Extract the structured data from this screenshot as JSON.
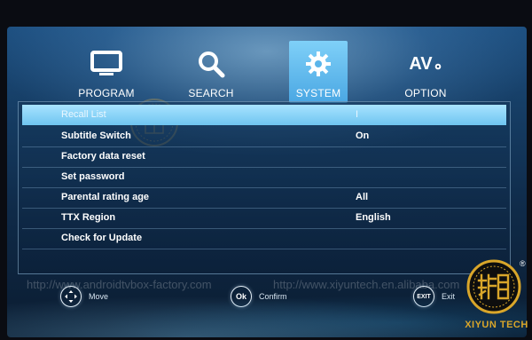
{
  "tabs": [
    {
      "label": "PROGRAM",
      "icon": "monitor-icon",
      "active": false
    },
    {
      "label": "SEARCH",
      "icon": "search-icon",
      "active": false
    },
    {
      "label": "SYSTEM",
      "icon": "gear-icon",
      "active": true
    },
    {
      "label": "OPTION",
      "icon": "av-settings-icon",
      "active": false,
      "icon_text": "AV"
    }
  ],
  "menu": {
    "rows": [
      {
        "label": "Recall List",
        "value": "I",
        "selected": true
      },
      {
        "label": "Subtitle Switch",
        "value": "On",
        "selected": false
      },
      {
        "label": "Factory data reset",
        "value": "",
        "selected": false
      },
      {
        "label": "Set password",
        "value": "",
        "selected": false
      },
      {
        "label": "Parental rating age",
        "value": "All",
        "selected": false
      },
      {
        "label": "TTX Region",
        "value": "English",
        "selected": false
      },
      {
        "label": "Check for Update",
        "value": "",
        "selected": false
      }
    ]
  },
  "watermark": {
    "left": "http://www.androidtvbox-factory.com",
    "right": "http://www.xiyuntech.en.alibaba.com"
  },
  "footer": {
    "move": {
      "icon_text": "",
      "label": "Move"
    },
    "confirm": {
      "icon_text": "Ok",
      "label": "Confirm"
    },
    "exit": {
      "icon_text": "EXIT",
      "label": "Exit"
    }
  },
  "brand": {
    "name": "XIYUN TECH",
    "registered": "®",
    "center_mark": "XIYUN TECH"
  },
  "colors": {
    "accent": "#6fc5f0",
    "brand_gold": "#d9a62a",
    "bg_top": "#1d4f80",
    "bg_bottom": "#0b1c30"
  }
}
